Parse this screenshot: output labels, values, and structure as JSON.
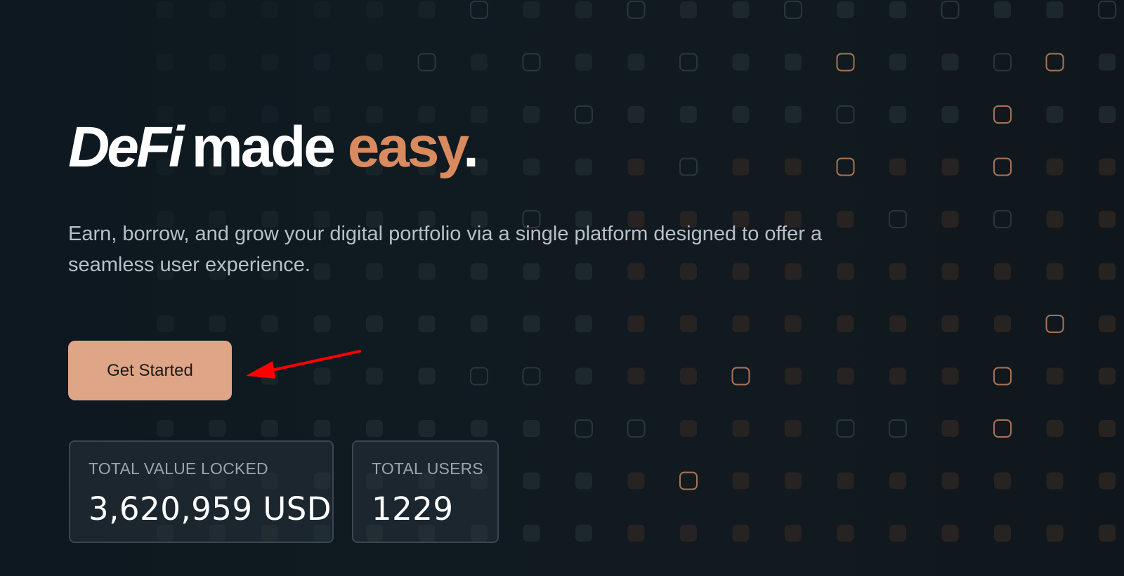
{
  "hero": {
    "headline_brand": "DeFi",
    "headline_middle": "made",
    "headline_accent": "easy",
    "headline_period": ".",
    "subtitle": "Earn, borrow, and grow your digital portfolio via a single platform designed to offer a seamless user experience.",
    "cta_label": "Get Started"
  },
  "stats": [
    {
      "label": "TOTAL VALUE LOCKED",
      "value": "3,620,959 USD"
    },
    {
      "label": "TOTAL USERS",
      "value": "1229"
    }
  ],
  "icons": {
    "annotation": "red-arrow-icon",
    "background": "dot-grid-pattern"
  },
  "colors": {
    "background": "#0f1a21",
    "accent": "#d98b5f",
    "button": "#dfa587",
    "arrow": "#ff0000"
  }
}
